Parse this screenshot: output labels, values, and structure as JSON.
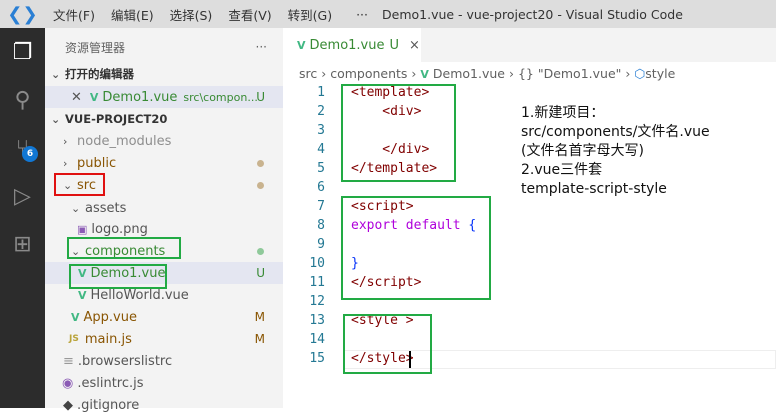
{
  "titlebar": {
    "menus": [
      "文件(F)",
      "编辑(E)",
      "选择(S)",
      "查看(V)",
      "转到(G)",
      "···"
    ],
    "title": "Demo1.vue - vue-project20 - Visual Studio Code"
  },
  "activity": {
    "items": [
      "files-icon",
      "search-icon",
      "source-control-icon",
      "run-debug-icon",
      "extensions-icon"
    ],
    "badge": "6"
  },
  "sidebar": {
    "title": "资源管理器",
    "more": "···",
    "open_editors": "打开的编辑器",
    "open_file": {
      "name": "Demo1.vue",
      "path": "src\\compon...",
      "status": "U"
    },
    "project": "VUE-PROJECT20",
    "tree": [
      {
        "name": "node_modules",
        "type": "folder",
        "collapsed": true
      },
      {
        "name": "public",
        "type": "folder",
        "collapsed": true
      },
      {
        "name": "src",
        "type": "folder"
      },
      {
        "name": "assets",
        "type": "folder"
      },
      {
        "name": "logo.png",
        "type": "image"
      },
      {
        "name": "components",
        "type": "folder"
      },
      {
        "name": "Demo1.vue",
        "type": "vue",
        "status": "U"
      },
      {
        "name": "HelloWorld.vue",
        "type": "vue"
      },
      {
        "name": "App.vue",
        "type": "vue",
        "status": "M"
      },
      {
        "name": "main.js",
        "type": "js",
        "status": "M"
      },
      {
        "name": ".browserslistrc",
        "type": "text"
      },
      {
        "name": ".eslintrc.js",
        "type": "eslint"
      },
      {
        "name": ".gitignore",
        "type": "git"
      }
    ]
  },
  "editor": {
    "tab": {
      "name": "Demo1.vue",
      "status": "U",
      "close": "×"
    },
    "breadcrumb": [
      "src",
      "components",
      "Demo1.vue",
      "{} \"Demo1.vue\"",
      "style"
    ],
    "lines": [
      "<template>",
      "    <div>",
      "",
      "    </div>",
      "</template>",
      "",
      "<script>",
      "export default {",
      "",
      "}",
      "</script>",
      "",
      "<style >",
      "",
      "</style>"
    ],
    "note": [
      "1.新建项目：",
      "src/components/文件名.vue",
      "(文件名首字母大写)",
      "2.vue三件套",
      "template-script-style"
    ]
  },
  "colors": {
    "accent": "#22aa44",
    "highlight": "#e01010",
    "vue": "#41b883"
  }
}
